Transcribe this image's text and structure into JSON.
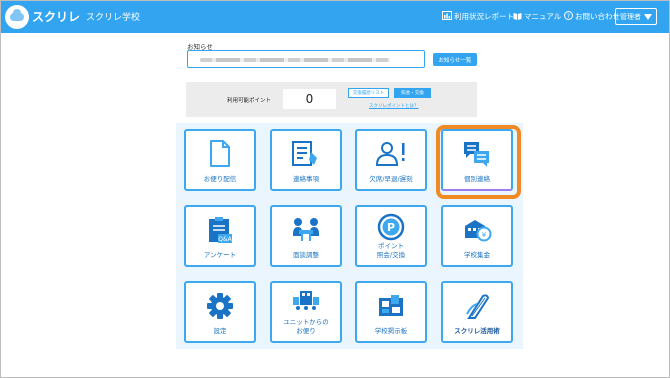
{
  "header": {
    "brand": "スクリレ",
    "school": "スクリレ学校",
    "nav": [
      {
        "icon": "report-icon",
        "label": "利用状況レポート"
      },
      {
        "icon": "book-icon",
        "label": "マニュアル"
      },
      {
        "icon": "help-icon",
        "label": "お問い合わせ"
      }
    ],
    "admin_label": "管理者"
  },
  "notice": {
    "title": "お知らせ",
    "list_button": "お知らせ一覧"
  },
  "points": {
    "label": "利用可能ポイント",
    "value": "0",
    "history_button": "交換履歴リスト",
    "exchange_button": "照会・交換",
    "what_link": "スクリレポイントとは？"
  },
  "menu": [
    {
      "id": "delivery",
      "icon": "document-icon",
      "label": "お便り配信"
    },
    {
      "id": "contact",
      "icon": "clipboard-pen-icon",
      "label": "連絡事項"
    },
    {
      "id": "absence",
      "icon": "person-alert-icon",
      "label": "欠席/早退/遅刻"
    },
    {
      "id": "individual",
      "icon": "chat-bubbles-icon",
      "label": "個別連絡"
    },
    {
      "id": "survey",
      "icon": "survey-board-icon",
      "label": "アンケート"
    },
    {
      "id": "interview",
      "icon": "meeting-icon",
      "label": "面談調整"
    },
    {
      "id": "points",
      "icon": "point-coin-icon",
      "label": "ポイント\n照会/交換"
    },
    {
      "id": "fees",
      "icon": "school-fee-icon",
      "label": "学校集金"
    },
    {
      "id": "settings",
      "icon": "gear-icon",
      "label": "設定"
    },
    {
      "id": "unit",
      "icon": "community-icon",
      "label": "ユニットからの\nお便り"
    },
    {
      "id": "board",
      "icon": "bulletin-board-icon",
      "label": "学校掲示板"
    },
    {
      "id": "guide",
      "icon": "guide-book-icon",
      "label": "スクリレ活用術"
    }
  ],
  "accent": "#33a5f0",
  "highlight_color": "#f08a24"
}
